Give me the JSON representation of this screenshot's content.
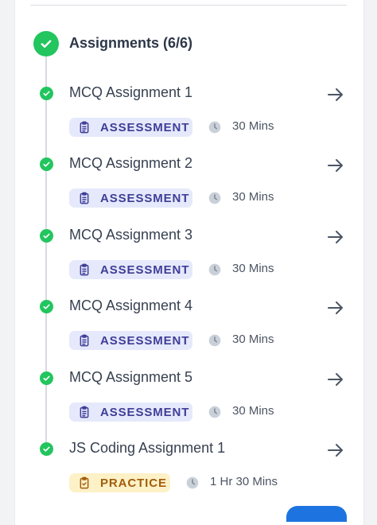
{
  "section": {
    "title": "Assignments (6/6)"
  },
  "items": [
    {
      "title": "MCQ Assignment 1",
      "badge": "ASSESSMENT",
      "type": "assessment",
      "duration": "30 Mins"
    },
    {
      "title": "MCQ Assignment 2",
      "badge": "ASSESSMENT",
      "type": "assessment",
      "duration": "30 Mins"
    },
    {
      "title": "MCQ Assignment 3",
      "badge": "ASSESSMENT",
      "type": "assessment",
      "duration": "30 Mins"
    },
    {
      "title": "MCQ Assignment 4",
      "badge": "ASSESSMENT",
      "type": "assessment",
      "duration": "30 Mins"
    },
    {
      "title": "MCQ Assignment 5",
      "badge": "ASSESSMENT",
      "type": "assessment",
      "duration": "30 Mins"
    },
    {
      "title": "JS Coding Assignment 1",
      "badge": "PRACTICE",
      "type": "practice",
      "duration": "1 Hr 30 Mins"
    }
  ],
  "colors": {
    "success": "#22c55e",
    "assessment_bg": "#e5e9fb",
    "assessment_text": "#3f3d97",
    "practice_bg": "#fdf1c7",
    "practice_text": "#a35d0b",
    "primary": "#1d74e0"
  },
  "icons": {
    "status": "check-circle-icon",
    "open": "arrow-right-icon",
    "assessment": "clipboard-list-icon",
    "practice": "clipboard-check-icon",
    "duration": "clock-icon"
  }
}
